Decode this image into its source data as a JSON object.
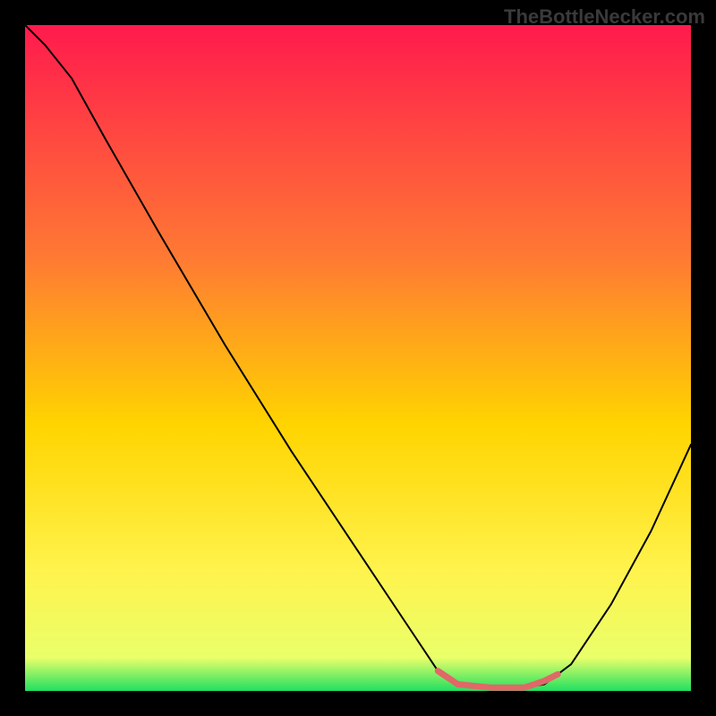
{
  "watermark": "TheBottleNecker.com",
  "chart_data": {
    "type": "line",
    "title": "",
    "xlabel": "",
    "ylabel": "",
    "xlim": [
      0,
      100
    ],
    "ylim": [
      0,
      100
    ],
    "gradient_stops": [
      {
        "offset": 0,
        "color": "#ff1a4d"
      },
      {
        "offset": 35,
        "color": "#ff7a33"
      },
      {
        "offset": 60,
        "color": "#ffd400"
      },
      {
        "offset": 82,
        "color": "#fff34d"
      },
      {
        "offset": 95,
        "color": "#eaff6a"
      },
      {
        "offset": 100,
        "color": "#20e060"
      }
    ],
    "series": [
      {
        "name": "curve",
        "color": "#000000",
        "width": 2,
        "points": [
          {
            "x": 0,
            "y": 100
          },
          {
            "x": 3,
            "y": 97
          },
          {
            "x": 7,
            "y": 92
          },
          {
            "x": 12,
            "y": 83
          },
          {
            "x": 20,
            "y": 69
          },
          {
            "x": 30,
            "y": 52
          },
          {
            "x": 40,
            "y": 36
          },
          {
            "x": 50,
            "y": 21
          },
          {
            "x": 58,
            "y": 9
          },
          {
            "x": 62,
            "y": 3
          },
          {
            "x": 65,
            "y": 1
          },
          {
            "x": 70,
            "y": 0.5
          },
          {
            "x": 75,
            "y": 0.5
          },
          {
            "x": 78,
            "y": 1
          },
          {
            "x": 82,
            "y": 4
          },
          {
            "x": 88,
            "y": 13
          },
          {
            "x": 94,
            "y": 24
          },
          {
            "x": 100,
            "y": 37
          }
        ]
      },
      {
        "name": "highlight",
        "color": "#e06868",
        "width": 7,
        "points": [
          {
            "x": 62,
            "y": 3
          },
          {
            "x": 65,
            "y": 1
          },
          {
            "x": 70,
            "y": 0.5
          },
          {
            "x": 75,
            "y": 0.5
          },
          {
            "x": 78,
            "y": 1.5
          },
          {
            "x": 80,
            "y": 2.5
          }
        ]
      }
    ]
  }
}
